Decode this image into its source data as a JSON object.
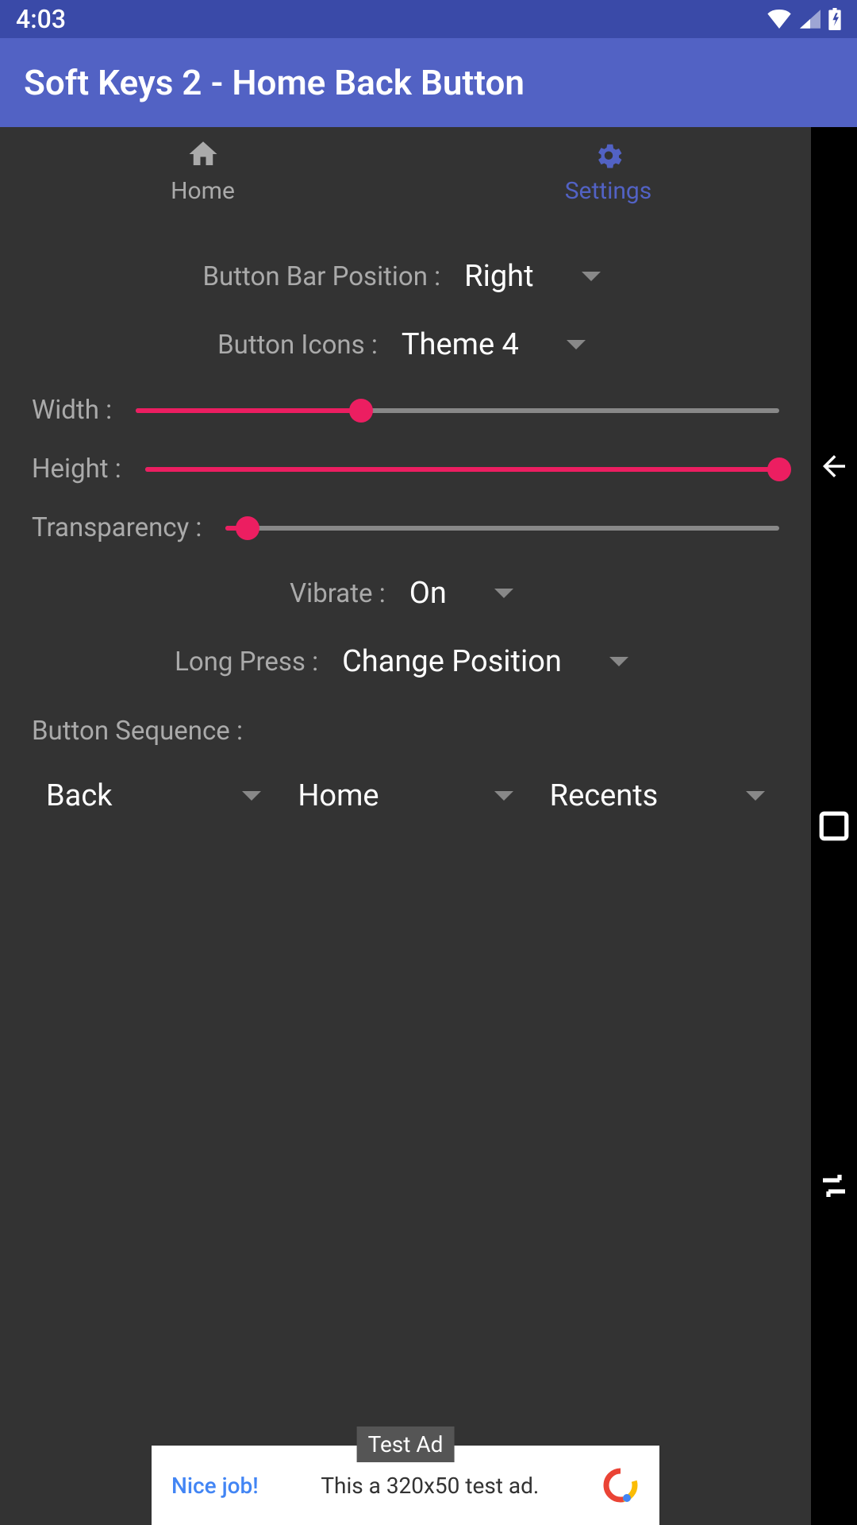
{
  "status_bar": {
    "time": "4:03"
  },
  "app_bar": {
    "title": "Soft Keys 2 - Home Back Button"
  },
  "tabs": {
    "home": "Home",
    "settings": "Settings"
  },
  "settings": {
    "button_bar_position": {
      "label": "Button Bar Position :",
      "value": "Right"
    },
    "button_icons": {
      "label": "Button Icons :",
      "value": "Theme 4"
    },
    "width": {
      "label": "Width :",
      "percent": 35
    },
    "height": {
      "label": "Height :",
      "percent": 100
    },
    "transparency": {
      "label": "Transparency :",
      "percent": 4
    },
    "vibrate": {
      "label": "Vibrate :",
      "value": "On"
    },
    "long_press": {
      "label": "Long Press :",
      "value": "Change Position"
    },
    "button_sequence": {
      "label": "Button Sequence :",
      "items": [
        "Back",
        "Home",
        "Recents"
      ]
    }
  },
  "ad": {
    "badge": "Test Ad",
    "left": "Nice job!",
    "center": "This a 320x50 test ad."
  }
}
